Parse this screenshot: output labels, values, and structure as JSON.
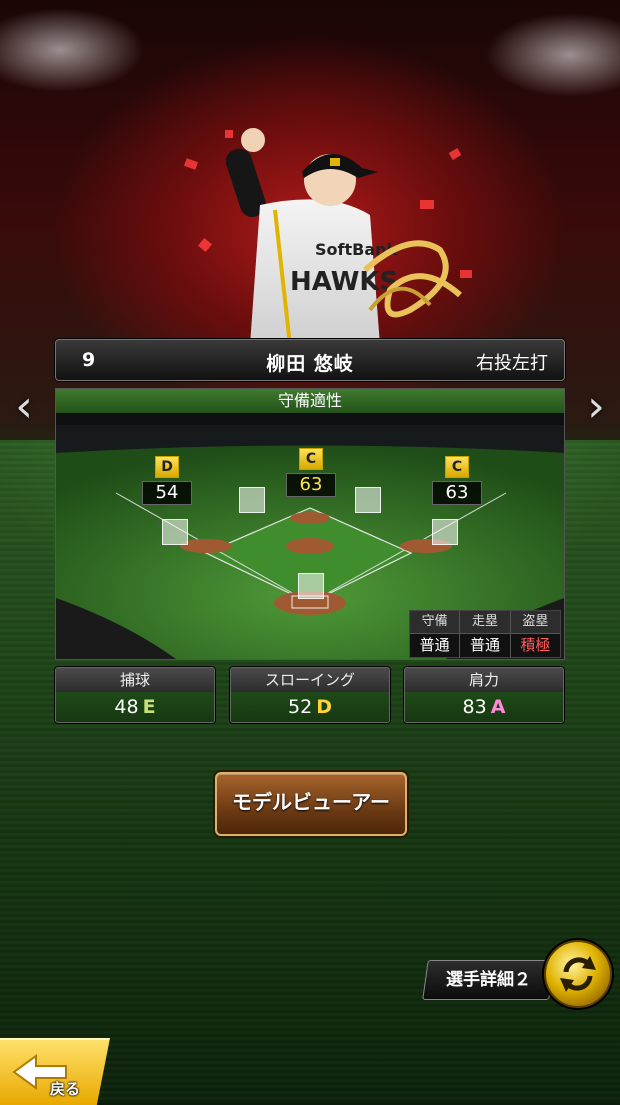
{
  "player": {
    "number": "9",
    "name": "柳田 悠岐",
    "handedness": "右投左打"
  },
  "defense": {
    "title": "守備適性",
    "positions": [
      {
        "grade": "D",
        "value": "54"
      },
      {
        "grade": "C",
        "value": "63"
      },
      {
        "grade": "C",
        "value": "63"
      }
    ],
    "mini_table": {
      "headers": [
        "守備",
        "走塁",
        "盗塁"
      ],
      "values": [
        "普通",
        "普通",
        "積極"
      ]
    }
  },
  "stats": [
    {
      "label": "捕球",
      "value": "48",
      "grade": "E"
    },
    {
      "label": "スローイング",
      "value": "52",
      "grade": "D"
    },
    {
      "label": "肩力",
      "value": "83",
      "grade": "A"
    }
  ],
  "buttons": {
    "model_viewer": "モデルビューアー",
    "player_detail": "選手詳細２",
    "back": "戻る"
  },
  "nav": {
    "prev": "‹",
    "next": "›"
  },
  "icons": {
    "prev": "chevron-left-icon",
    "next": "chevron-right-icon",
    "swap": "swap-arrows-icon",
    "back": "back-arrow-icon"
  },
  "colors": {
    "grade_box": "#ffd23a",
    "highlight_value": "#ffe34a",
    "aggressive": "#ff5a5a",
    "grade_a": "#ff8ad8"
  }
}
